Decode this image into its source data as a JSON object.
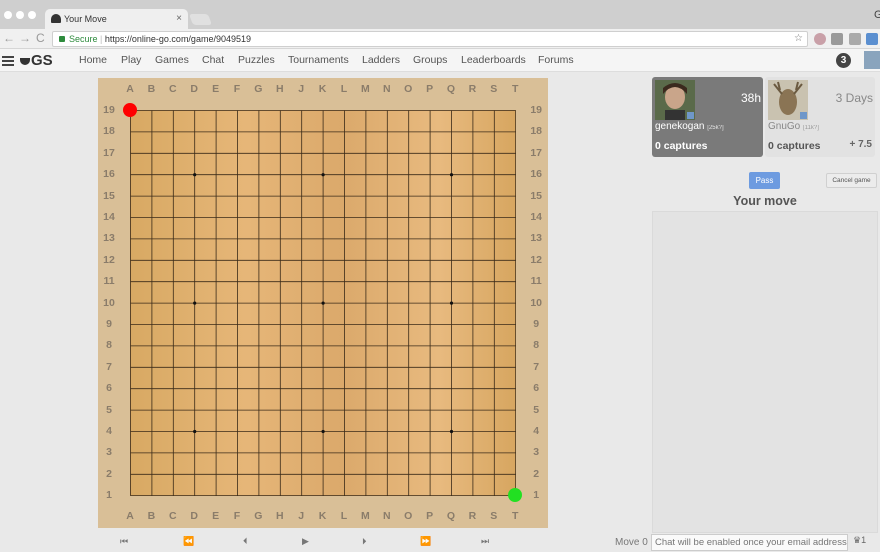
{
  "browser": {
    "tab_title": "Your Move",
    "tab_close": "×",
    "secure_label": "Secure",
    "url": "https://online-go.com/game/9049519",
    "back_icon": "←",
    "forward_icon": "→",
    "reload_icon": "C",
    "star_icon": "☆",
    "profile_letter": "G"
  },
  "site": {
    "logo": "GS",
    "nav": [
      "Home",
      "Play",
      "Games",
      "Chat",
      "Puzzles",
      "Tournaments",
      "Ladders",
      "Groups",
      "Leaderboards",
      "Forums"
    ],
    "notification_count": "3"
  },
  "board": {
    "columns": [
      "A",
      "B",
      "C",
      "D",
      "E",
      "F",
      "G",
      "H",
      "J",
      "K",
      "L",
      "M",
      "N",
      "O",
      "P",
      "Q",
      "R",
      "S",
      "T"
    ],
    "rows": [
      "19",
      "18",
      "17",
      "16",
      "15",
      "14",
      "13",
      "12",
      "11",
      "10",
      "9",
      "8",
      "7",
      "6",
      "5",
      "4",
      "3",
      "2",
      "1"
    ],
    "size": 19,
    "star_points": [
      [
        4,
        4
      ],
      [
        10,
        4
      ],
      [
        16,
        4
      ],
      [
        4,
        10
      ],
      [
        10,
        10
      ],
      [
        16,
        10
      ],
      [
        4,
        16
      ],
      [
        10,
        16
      ],
      [
        16,
        16
      ]
    ],
    "stones": [
      {
        "col": "A",
        "row": "19",
        "color": "#ff0000"
      },
      {
        "col": "T",
        "row": "1",
        "color": "#22e022"
      }
    ],
    "colors": {
      "frame": "#d9bf97",
      "wood": "#e2b274",
      "line": "#3a2a18"
    }
  },
  "playback": {
    "first": "⏮",
    "back10": "⏪",
    "prev": "⏴",
    "play": "▶",
    "next": "⏵",
    "fwd10": "⏩",
    "last": "⏭"
  },
  "players": {
    "black": {
      "name": "genekogan",
      "rank": "[25k?]",
      "time": "38h",
      "captures": "0 captures"
    },
    "white": {
      "name": "GnuGo",
      "rank": "[11k?]",
      "time": "3 Days",
      "captures": "0 captures",
      "komi": "+ 7.5"
    }
  },
  "controls": {
    "pass": "Pass",
    "cancel": "Cancel game",
    "your_move": "Your move"
  },
  "chat": {
    "move_label": "Move 0",
    "placeholder": "Chat will be enabled once your email address",
    "user_count": "1"
  }
}
